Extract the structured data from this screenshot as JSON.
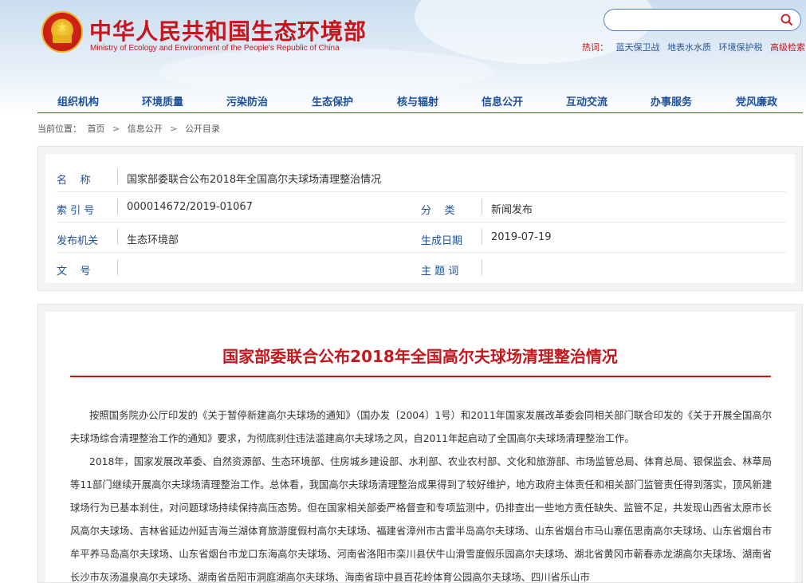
{
  "site": {
    "title": "中华人民共和国生态环境部",
    "subtitle": "Ministry of Ecology and Environment of the People's Republic of China"
  },
  "search": {
    "placeholder": "",
    "hot_label": "热词：",
    "hot_words": [
      "蓝天保卫战",
      "地表水水质",
      "环境保护税"
    ],
    "advanced": "高级检索"
  },
  "nav": {
    "items": [
      "组织机构",
      "环境质量",
      "污染防治",
      "生态保护",
      "核与辐射",
      "信息公开",
      "互动交流",
      "办事服务",
      "党风廉政"
    ]
  },
  "breadcrumb": {
    "label": "当前位置：",
    "items": [
      "首页",
      "信息公开",
      "公开目录"
    ],
    "sep": ">"
  },
  "meta": {
    "name_label": "名    称",
    "name_value": "国家部委联合公布2018年全国高尔夫球场清理整治情况",
    "index_label": "索 引 号",
    "index_value": "000014672/2019-01067",
    "category_label": "分    类",
    "category_value": "新闻发布",
    "issuer_label": "发布机关",
    "issuer_value": "生态环境部",
    "date_label": "生成日期",
    "date_value": "2019-07-19",
    "docno_label": "文    号",
    "docno_value": "",
    "keywords_label": "主 题 词",
    "keywords_value": ""
  },
  "article": {
    "title": "国家部委联合公布2018年全国高尔夫球场清理整治情况",
    "p1": "按照国务院办公厅印发的《关于暂停新建高尔夫球场的通知》（国办发〔2004〕1号）和2011年国家发展改革委会同相关部门联合印发的《关于开展全国高尔夫球场综合清理整治工作的通知》要求，为彻底刹住违法滥建高尔夫球场之风，自2011年起启动了全国高尔夫球场清理整治工作。",
    "p2": "2018年，国家发展改革委、自然资源部、生态环境部、住房城乡建设部、水利部、农业农村部、文化和旅游部、市场监管总局、体育总局、银保监会、林草局等11部门继续开展高尔夫球场清理整治工作。总体看，我国高尔夫球场清理整治成果得到了较好维护，地方政府主体责任和相关部门监管责任得到落实，顶风新建球场行为已基本刹住，对问题球场持续保持高压态势。但在国家相关部委严格督查和专项监测中，仍排查出一些地方责任缺失、监管不足，共发现山西省太原市长风高尔夫球场、吉林省延边州延吉海兰湖体育旅游度假村高尔夫球场、福建省漳州市古雷半岛高尔夫球场、山东省烟台市马山寨伍思南高尔夫球场、山东省烟台市牟平养马岛高尔夫球场、山东省烟台市龙口东海高尔夫球场、河南省洛阳市栾川县伏牛山滑雪度假乐园高尔夫球场、湖北省黄冈市蕲春赤龙湖高尔夫球场、湖南省长沙市灰汤温泉高尔夫球场、湖南省岳阳市洞庭湖高尔夫球场、海南省琼中县百花岭体育公园高尔夫球场、四川省乐山市"
  },
  "colors": {
    "brand_red": "#c4161c",
    "nav_blue": "#1b4f9c"
  }
}
